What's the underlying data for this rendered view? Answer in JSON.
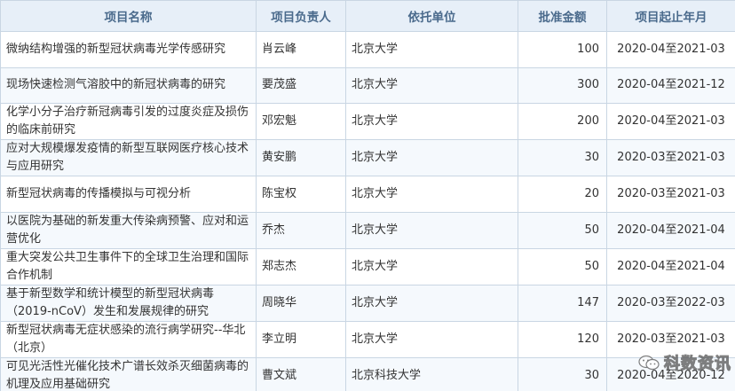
{
  "table": {
    "headers": [
      "项目名称",
      "项目负责人",
      "依托单位",
      "批准金额",
      "项目起止年月"
    ],
    "rows": [
      {
        "name": "微纳结构增强的新型冠状病毒光学传感研究",
        "pi": "肖云峰",
        "org": "北京大学",
        "amount": "100",
        "period": "2020-04至2021-03"
      },
      {
        "name": "现场快速检测气溶胶中的新冠状病毒的研究",
        "pi": "要茂盛",
        "org": "北京大学",
        "amount": "300",
        "period": "2020-04至2021-12"
      },
      {
        "name": "化学小分子治疗新冠病毒引发的过度炎症及损伤的临床前研究",
        "pi": "邓宏魁",
        "org": "北京大学",
        "amount": "200",
        "period": "2020-04至2021-03"
      },
      {
        "name": "应对大规模爆发疫情的新型互联网医疗核心技术与应用研究",
        "pi": "黄安鹏",
        "org": "北京大学",
        "amount": "30",
        "period": "2020-03至2021-03"
      },
      {
        "name": "新型冠状病毒的传播模拟与可视分析",
        "pi": "陈宝权",
        "org": "北京大学",
        "amount": "20",
        "period": "2020-03至2021-03"
      },
      {
        "name": "以医院为基础的新发重大传染病预警、应对和运营优化",
        "pi": "乔杰",
        "org": "北京大学",
        "amount": "50",
        "period": "2020-04至2021-04"
      },
      {
        "name": "重大突发公共卫生事件下的全球卫生治理和国际合作机制",
        "pi": "郑志杰",
        "org": "北京大学",
        "amount": "50",
        "period": "2020-04至2021-04"
      },
      {
        "name": "基于新型数学和统计模型的新型冠状病毒（2019-nCoV）发生和发展规律的研究",
        "pi": "周晓华",
        "org": "北京大学",
        "amount": "147",
        "period": "2020-03至2022-03"
      },
      {
        "name": "新型冠状病毒无症状感染的流行病学研究--华北（北京）",
        "pi": "李立明",
        "org": "北京大学",
        "amount": "120",
        "period": "2020-03至2021-03"
      },
      {
        "name": "可见光活性光催化技术广谱长效杀灭细菌病毒的机理及应用基础研究",
        "pi": "曹文斌",
        "org": "北京科技大学",
        "amount": "30",
        "period": "2020-04至2020-12"
      }
    ]
  },
  "watermark": {
    "text": "科数资讯",
    "icon": "wechat-icon"
  },
  "colors": {
    "header_bg": "#e7eff8",
    "header_text": "#4a6a8c",
    "border": "#c9d6e3",
    "row_alt_bg": "#f5f9fd"
  }
}
